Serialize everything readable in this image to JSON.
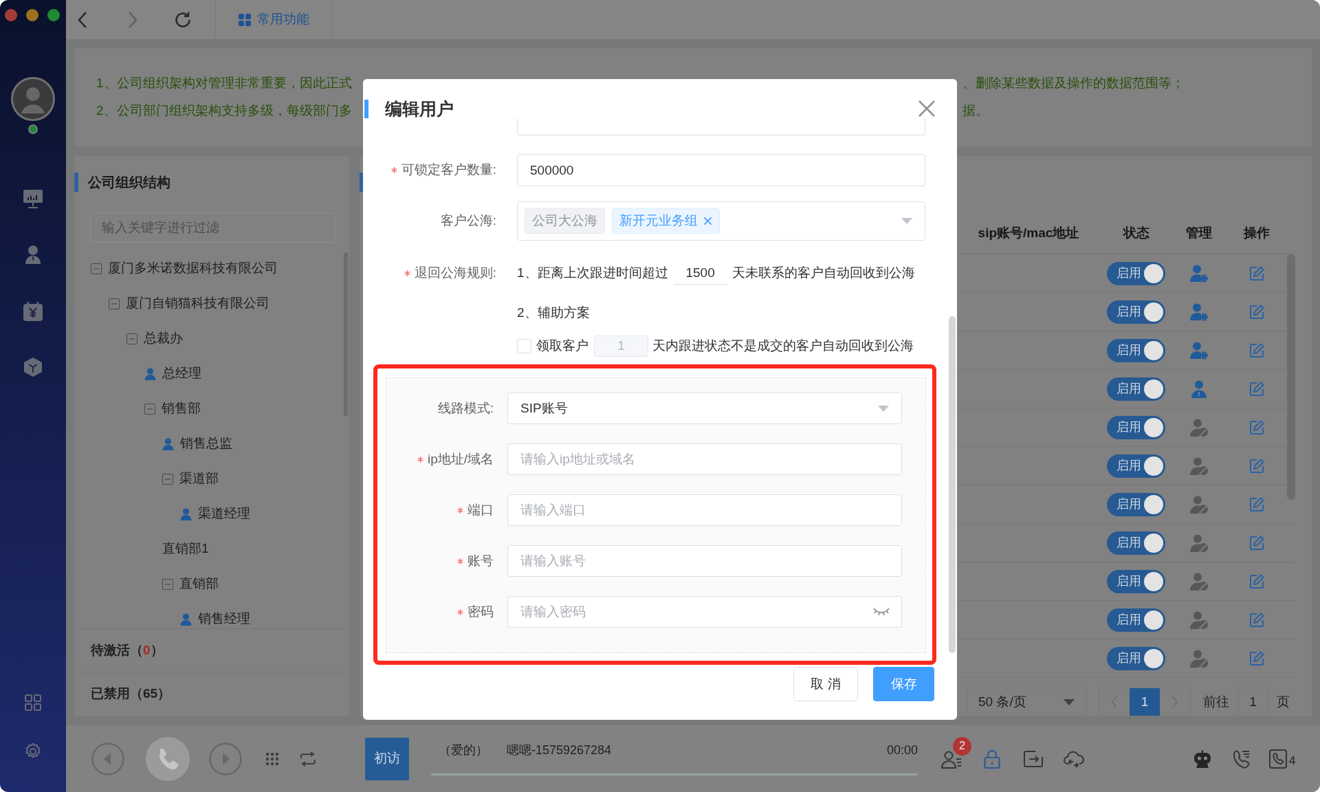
{
  "toolbar": {
    "tabs": [
      {
        "label": "常用功能",
        "selected": true
      }
    ]
  },
  "user_status": {
    "online": true
  },
  "notice": {
    "lines": [
      {
        "parts": [
          "1、公司组织架构对管理非常重要，因此正式",
          "、删除某些数据及操作的数据范围等；"
        ]
      },
      {
        "parts": [
          "2、公司部门组织架构支持多级，每级部门多",
          "据。"
        ]
      }
    ]
  },
  "org_panel": {
    "title": "公司组织结构",
    "filter": {
      "placeholder": "输入关键字进行过滤"
    },
    "tree": [
      {
        "label": "厦门多米诺数据科技有限公司",
        "kind": "department",
        "expanded": true,
        "children": [
          {
            "label": "厦门自销猫科技有限公司",
            "kind": "department",
            "expanded": true,
            "children": [
              {
                "label": "总裁办",
                "kind": "department",
                "expanded": true,
                "children": [
                  {
                    "label": "总经理",
                    "kind": "person"
                  },
                  {
                    "label": "销售部",
                    "kind": "department",
                    "expanded": true,
                    "children": [
                      {
                        "label": "销售总监",
                        "kind": "person"
                      },
                      {
                        "label": "渠道部",
                        "kind": "department",
                        "expanded": true,
                        "children": [
                          {
                            "label": "渠道经理",
                            "kind": "person"
                          }
                        ]
                      },
                      {
                        "label": "直销部1",
                        "kind": "department"
                      },
                      {
                        "label": "直销部",
                        "kind": "department",
                        "expanded": true,
                        "children": [
                          {
                            "label": "销售经理",
                            "kind": "person"
                          }
                        ]
                      }
                    ]
                  }
                ]
              }
            ]
          }
        ]
      }
    ],
    "status_rows": [
      {
        "label": "待激活",
        "open": "（",
        "count": "0",
        "close": "）",
        "alert": true
      },
      {
        "label": "已禁用",
        "open": "（",
        "count": "65",
        "close": "）",
        "alert": false
      }
    ]
  },
  "table": {
    "columns": [
      {
        "label": "sip账号/mac地址"
      },
      {
        "label": "状态"
      },
      {
        "label": "管理"
      },
      {
        "label": "操作"
      }
    ],
    "rows": [
      {
        "status_label": "启用",
        "enabled": true,
        "manage": {
          "kind": "admin"
        }
      },
      {
        "status_label": "启用",
        "enabled": true,
        "manage": {
          "kind": "admin"
        }
      },
      {
        "status_label": "启用",
        "enabled": true,
        "manage": {
          "kind": "admin"
        }
      },
      {
        "status_label": "启用",
        "enabled": true,
        "manage": {
          "kind": "user"
        }
      },
      {
        "status_label": "启用",
        "enabled": true,
        "manage": {
          "kind": "disabled"
        }
      },
      {
        "status_label": "启用",
        "enabled": true,
        "manage": {
          "kind": "disabled"
        }
      },
      {
        "status_label": "启用",
        "enabled": true,
        "manage": {
          "kind": "disabled"
        }
      },
      {
        "status_label": "启用",
        "enabled": true,
        "manage": {
          "kind": "disabled"
        }
      },
      {
        "status_label": "启用",
        "enabled": true,
        "manage": {
          "kind": "disabled"
        }
      },
      {
        "status_label": "启用",
        "enabled": true,
        "manage": {
          "kind": "disabled"
        }
      },
      {
        "status_label": "启用",
        "enabled": true,
        "manage": {
          "kind": "disabled"
        }
      }
    ]
  },
  "pagination": {
    "page_size": "50 条/页",
    "pages": [
      {
        "label": "1",
        "selected": true
      }
    ],
    "goto_label": "前往",
    "goto_value": "1",
    "page_unit": "页"
  },
  "dialog": {
    "title": "编辑用户",
    "fields": [
      {
        "kind": "cut_off"
      },
      {
        "kind": "input",
        "label": "可锁定客户数量:",
        "required": true,
        "value": "500000"
      },
      {
        "kind": "tags",
        "label": "客户公海:",
        "required": false,
        "tags": [
          {
            "label": "公司大公海",
            "closable": false
          },
          {
            "label": "新开元业务组",
            "closable": true
          }
        ]
      },
      {
        "kind": "rule",
        "label": "退回公海规则:",
        "required": true,
        "rule": {
          "before": "1、距离上次跟进时间超过",
          "days": "1500",
          "after": "天未联系的客户自动回收到公海"
        },
        "subtitle": "2、辅助方案",
        "option": {
          "label": "领取客户",
          "checked": false,
          "days": "1",
          "days_disabled": true,
          "after": "天内跟进状态不是成交的客户自动回收到公海"
        }
      }
    ],
    "line_section": {
      "highlighted": true,
      "fields": [
        {
          "kind": "select",
          "label": "线路模式:",
          "required": false,
          "value": "SIP账号"
        },
        {
          "kind": "input",
          "label": "ip地址/域名",
          "required": true,
          "placeholder": "请输入ip地址或域名"
        },
        {
          "kind": "input",
          "label": "端口",
          "required": true,
          "placeholder": "请输入端口"
        },
        {
          "kind": "input",
          "label": "账号",
          "required": true,
          "placeholder": "请输入账号"
        },
        {
          "kind": "password",
          "label": "密码",
          "required": true,
          "placeholder": "请输入密码"
        }
      ]
    },
    "buttons": [
      {
        "label": "取 消",
        "kind": "default"
      },
      {
        "label": "保存",
        "kind": "primary"
      }
    ]
  },
  "call_bar": {
    "tag": "初访",
    "caller": "（爱的）",
    "contact": "嗯嗯-15759267284",
    "timer": "00:00",
    "unread": "2",
    "line_count": "4"
  }
}
